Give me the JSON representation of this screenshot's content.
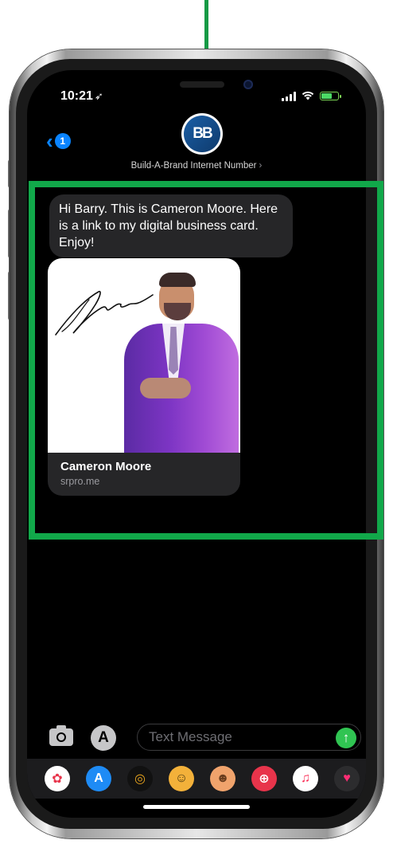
{
  "status_bar": {
    "time": "10:21",
    "location_glyph": "➶",
    "icons": [
      "signal-icon",
      "wifi-icon",
      "battery-charging-icon"
    ]
  },
  "header": {
    "back_badge_count": "1",
    "avatar_initials": "BB",
    "contact_name": "Build-A-Brand Internet Number",
    "contact_chevron": "›"
  },
  "messages": [
    {
      "type": "text",
      "text": "Hi Barry. This is Cameron Moore. Here is a link to my digital business card. Enjoy!"
    },
    {
      "type": "link_preview",
      "title": "Cameron Moore",
      "url": "srpro.me"
    }
  ],
  "composer": {
    "placeholder": "Text Message",
    "send_glyph": "↑",
    "apps_glyph": "A"
  },
  "app_drawer": {
    "apps": [
      {
        "name": "photos-icon",
        "glyph": "✿",
        "color": "#ffffff"
      },
      {
        "name": "app-store-icon",
        "glyph": "A",
        "color": "#1e8bf5"
      },
      {
        "name": "activity-icon",
        "glyph": "◎",
        "color": "#111111"
      },
      {
        "name": "animoji-icon",
        "glyph": "☺",
        "color": "#f3b13a"
      },
      {
        "name": "memoji-icon",
        "glyph": "☻",
        "color": "#f0a36c"
      },
      {
        "name": "image-search-icon",
        "glyph": "⊕",
        "color": "#e8344b"
      },
      {
        "name": "music-icon",
        "glyph": "♫",
        "color": "#ffffff"
      },
      {
        "name": "digital-touch-icon",
        "glyph": "♥",
        "color": "#1c1c1e"
      }
    ]
  },
  "colors": {
    "annotation_green": "#11a84a",
    "imessage_blue": "#0a84ff",
    "send_green": "#30c452",
    "received_bubble": "#262628"
  }
}
